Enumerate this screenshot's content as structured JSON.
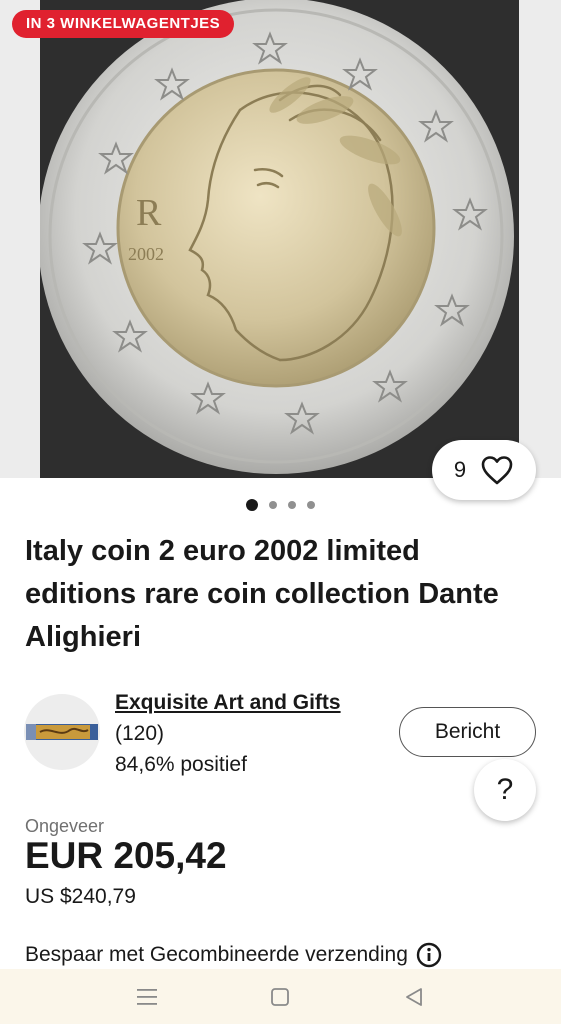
{
  "listing": {
    "cart_badge": "IN 3 WINKELWAGENTJES",
    "watch_count": "9",
    "image_count": 4,
    "active_image_index": 0,
    "title": "Italy coin 2 euro 2002 limited editions rare coin collection Dante Alighieri",
    "coin_mint_mark": "2002"
  },
  "seller": {
    "name": "Exquisite Art and Gifts",
    "score": "(120)",
    "feedback": "84,6% positief",
    "message_label": "Bericht"
  },
  "help": {
    "label": "?"
  },
  "price": {
    "approx_label": "Ongeveer",
    "main": "EUR 205,42",
    "usd": "US $240,79"
  },
  "shipping": {
    "text": "Bespaar met Gecombineerde verzending"
  },
  "icons": {
    "watch": "heart-icon",
    "info": "info-icon",
    "nav_recent": "menu-lines-icon",
    "nav_home": "square-icon",
    "nav_back": "triangle-back-icon"
  },
  "colors": {
    "badge_red": "#e0212f",
    "text_primary": "#191919",
    "text_secondary": "#707070",
    "nav_bg": "#fbf6ea"
  }
}
